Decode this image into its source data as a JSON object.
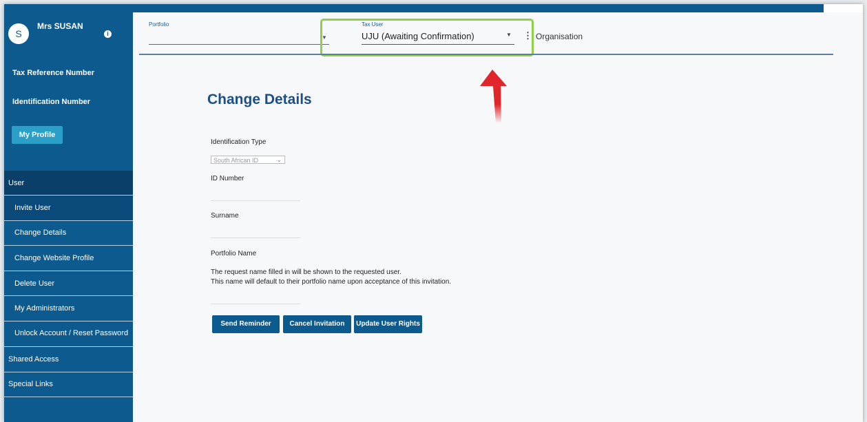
{
  "user": {
    "avatar_letter": "S",
    "name": "Mrs SUSAN"
  },
  "sidebar": {
    "tax_reference_label": "Tax Reference Number",
    "identification_label": "Identification Number",
    "profile_button": "My Profile",
    "menu": {
      "user_header": "User",
      "items": [
        "Invite User",
        "Change Details",
        "Change Website Profile",
        "Delete User",
        "My Administrators",
        "Unlock Account / Reset Password"
      ],
      "shared_access": "Shared Access",
      "special_links": "Special Links"
    }
  },
  "header": {
    "portfolio_label": "Portfolio",
    "tax_user_label": "Tax User",
    "tax_user_value": "UJU (Awaiting Confirmation)",
    "organisation": "Organisation"
  },
  "form": {
    "title": "Change Details",
    "identification_type_label": "Identification Type",
    "identification_type_value": "South African ID",
    "id_number_label": "ID Number",
    "surname_label": "Surname",
    "portfolio_name_label": "Portfolio Name",
    "note_line1": "The request name filled in will be shown to the requested user.",
    "note_line2": "This name will default to their portfolio name upon acceptance of this invitation.",
    "buttons": {
      "send_reminder": "Send Reminder",
      "cancel_invitation": "Cancel Invitation",
      "update_user_rights": "Update User Rights"
    }
  },
  "colors": {
    "sidebar": "#0d5a8f",
    "highlight_box": "#8fcf4a",
    "arrow": "#e0262b",
    "title": "#1d4f86"
  }
}
